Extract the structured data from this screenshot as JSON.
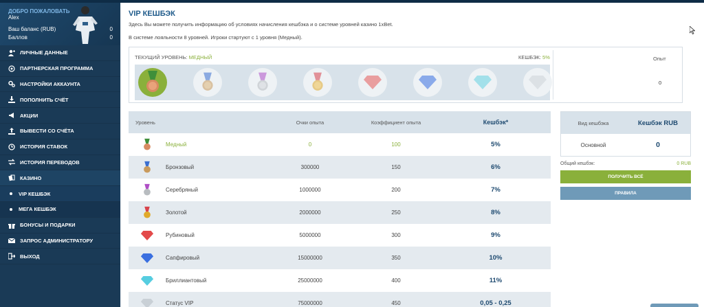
{
  "sidebar": {
    "welcome": "ДОБРО ПОЖАЛОВАТЬ",
    "username": "Alex",
    "balance_label": "Ваш баланс (RUB)",
    "balance_value": "0",
    "points_label": "Баллов",
    "points_value": "0",
    "items": [
      {
        "label": "ЛИЧНЫЕ ДАННЫЕ",
        "icon": "user-icon"
      },
      {
        "label": "ПАРТНЕРСКАЯ ПРОГРАММА",
        "icon": "partner-icon"
      },
      {
        "label": "НАСТРОЙКИ АККАУНТА",
        "icon": "gears-icon"
      },
      {
        "label": "ПОПОЛНИТЬ СЧЁТ",
        "icon": "download-icon"
      },
      {
        "label": "АКЦИИ",
        "icon": "megaphone-icon"
      },
      {
        "label": "ВЫВЕСТИ СО СЧЁТА",
        "icon": "upload-icon"
      },
      {
        "label": "ИСТОРИЯ СТАВОК",
        "icon": "clock-icon"
      },
      {
        "label": "ИСТОРИЯ ПЕРЕВОДОВ",
        "icon": "transfer-icon"
      },
      {
        "label": "КАЗИНО",
        "icon": "cards-icon"
      },
      {
        "label": "VIP КЕШБЭК",
        "icon": "dot-icon"
      },
      {
        "label": "МЕГА КЕШБЭК",
        "icon": "dot-icon"
      },
      {
        "label": "БОНУСЫ И ПОДАРКИ",
        "icon": "gift-icon"
      },
      {
        "label": "ЗАПРОС АДМИНИСТРАТОРУ",
        "icon": "mail-icon"
      },
      {
        "label": "ВЫХОД",
        "icon": "exit-icon"
      }
    ]
  },
  "main": {
    "title": "VIP КЕШБЭК",
    "intro": "Здесь Вы можете получить информацию об условиях начисления кешбэка и о системе уровней казино 1xBet.",
    "loyalty": "В системе лояльности 8 уровней. Игроки стартуют с 1 уровня (Медный).",
    "current_level_label": "ТЕКУЩИЙ УРОВЕНЬ:",
    "current_level_value": "МЕДНЫЙ",
    "cashback_label": "КЕШБЭК:",
    "cashback_value": "5%",
    "experience_label": "Опыт",
    "experience_value": "0"
  },
  "table": {
    "headers": {
      "level": "Уровень",
      "points": "Очки опыта",
      "coef": "Коэффициент опыта",
      "cashback": "Кешбэк*"
    },
    "rows": [
      {
        "name": "Медный",
        "points": "0",
        "coef": "100",
        "cashback": "5%",
        "icon": "copper-medal-icon"
      },
      {
        "name": "Бронзовый",
        "points": "300000",
        "coef": "150",
        "cashback": "6%",
        "icon": "bronze-medal-icon"
      },
      {
        "name": "Серебряный",
        "points": "1000000",
        "coef": "200",
        "cashback": "7%",
        "icon": "silver-medal-icon"
      },
      {
        "name": "Золотой",
        "points": "2000000",
        "coef": "250",
        "cashback": "8%",
        "icon": "gold-medal-icon"
      },
      {
        "name": "Рубиновый",
        "points": "5000000",
        "coef": "300",
        "cashback": "9%",
        "icon": "ruby-icon"
      },
      {
        "name": "Сапфировый",
        "points": "15000000",
        "coef": "350",
        "cashback": "10%",
        "icon": "sapphire-icon"
      },
      {
        "name": "Бриллиантовый",
        "points": "25000000",
        "coef": "400",
        "cashback": "11%",
        "icon": "diamond-icon"
      },
      {
        "name": "Статус VIP",
        "points": "75000000",
        "coef": "450",
        "cashback": "0,05 - 0,25",
        "icon": "vip-diamond-icon"
      }
    ]
  },
  "cashback_box": {
    "type_label": "Вид кешбэка",
    "currency_label": "Кешбэк RUB",
    "row_label": "Основной",
    "row_value": "0",
    "total_label": "Общий кешбэк:",
    "total_value": "0 RUB",
    "get_all": "ПОЛУЧИТЬ ВСЁ",
    "rules": "ПРАВИЛА"
  },
  "colors": {
    "accent": "#8ab03b",
    "sidebar": "#1a3a56",
    "header_bg": "#d8e2ea",
    "title": "#1e5a8a"
  }
}
